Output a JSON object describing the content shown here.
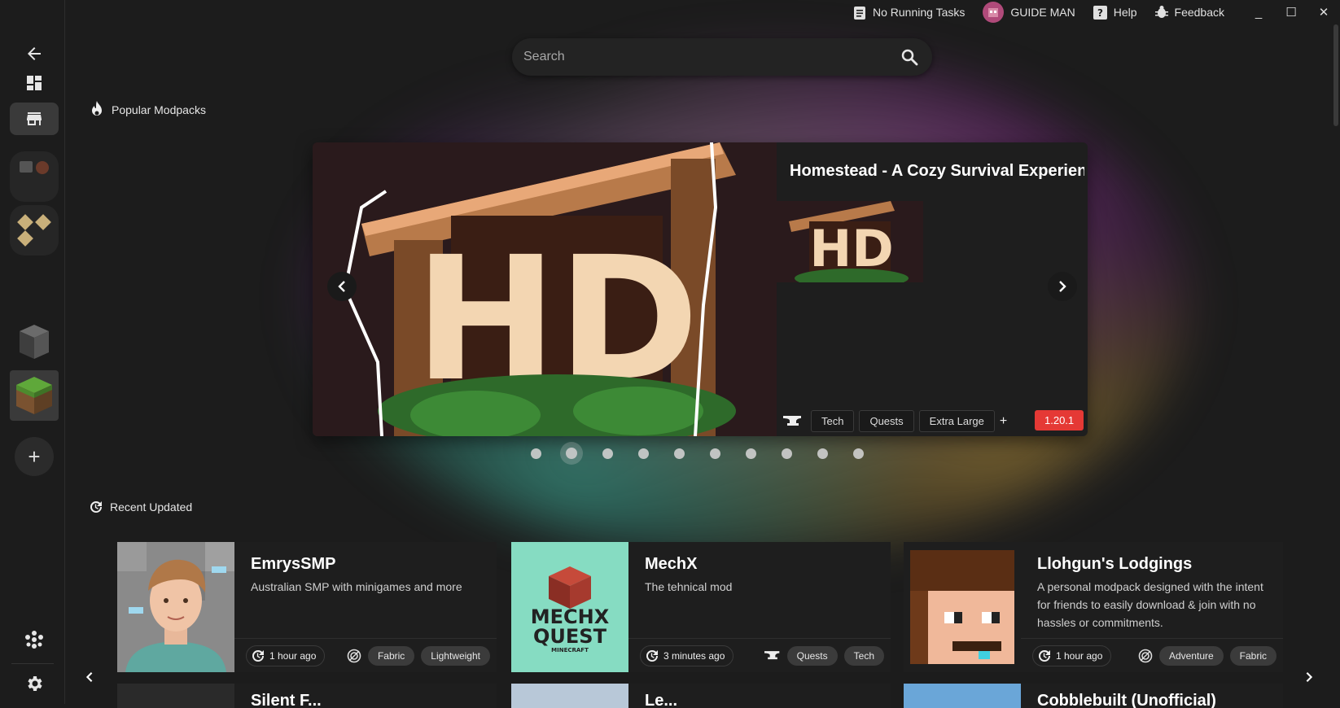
{
  "titlebar": {
    "tasks": "No Running Tasks",
    "user": "GUIDE MAN",
    "help": "Help",
    "feedback": "Feedback",
    "minimize": "_",
    "maximize": "☐",
    "close": "✕"
  },
  "search": {
    "placeholder": "Search"
  },
  "popular": {
    "title": "Popular Modpacks"
  },
  "hero": {
    "title": "Homestead - A Cozy Survival Experience",
    "logo_text": "HD",
    "tags": [
      "Tech",
      "Quests",
      "Extra Large"
    ],
    "more": "+",
    "version": "1.20.1",
    "slide_count": 10,
    "active_slide": 2
  },
  "recent": {
    "title": "Recent Updated",
    "cards": [
      {
        "name": "EmrysSMP",
        "description": "Australian SMP with minigames and more",
        "time": "1 hour ago",
        "loader_icon": "fabric-icon",
        "tags": [
          "Fabric",
          "Lightweight"
        ]
      },
      {
        "name": "MechX",
        "description": "The tehnical mod",
        "time": "3 minutes ago",
        "loader_icon": "anvil-icon",
        "tags": [
          "Quests",
          "Tech"
        ],
        "logo_text": [
          "MECHX",
          "QUEST"
        ],
        "logo_sub": "MINECRAFT"
      },
      {
        "name": "Llohgun's Lodgings",
        "description": "A personal modpack designed with the intent for friends to easily download & join with no hassles or commitments.",
        "time": "1 hour ago",
        "loader_icon": "fabric-icon",
        "tags": [
          "Adventure",
          "Fabric"
        ]
      }
    ],
    "peek": [
      "Silent F...",
      "Le...",
      "Cobblebuilt (Unofficial)"
    ]
  },
  "sidebar": {
    "add": "+"
  },
  "colors": {
    "accent_red": "#e53935",
    "background": "#1c1c1c"
  }
}
